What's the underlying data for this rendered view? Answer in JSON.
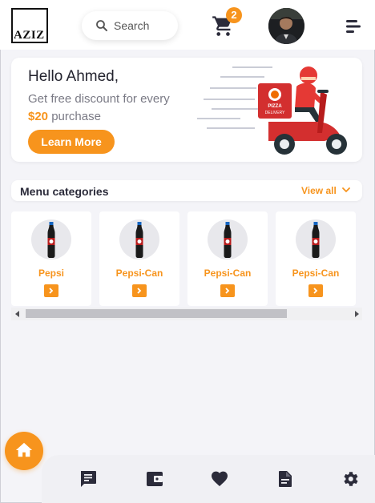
{
  "header": {
    "logo_text": "AZIZ",
    "search_placeholder": "Search",
    "cart_count": "2",
    "icons": [
      "search-icon",
      "cart-icon",
      "avatar",
      "menu-icon"
    ]
  },
  "promo": {
    "greeting": "Hello Ahmed,",
    "subtitle": "Get free discount for every",
    "amount": "$20",
    "amount_suffix": " purchase",
    "cta": "Learn More",
    "illustration_text": {
      "brand": "PIZZA",
      "label": "DELIVERY"
    }
  },
  "categories": {
    "title": "Menu categories",
    "view_all": "View all",
    "items": [
      {
        "name": "Pepsi"
      },
      {
        "name": "Pepsi-Can"
      },
      {
        "name": "Pepsi-Can"
      },
      {
        "name": "Pepsi-Can"
      }
    ]
  },
  "bottom_nav": {
    "items": [
      "home-icon",
      "chat-icon",
      "wallet-icon",
      "heart-icon",
      "document-icon",
      "gear-icon"
    ]
  },
  "colors": {
    "accent": "#f7941d",
    "background": "#f4f4f8",
    "card": "#ffffff",
    "icon_dark": "#2b2b3a"
  }
}
